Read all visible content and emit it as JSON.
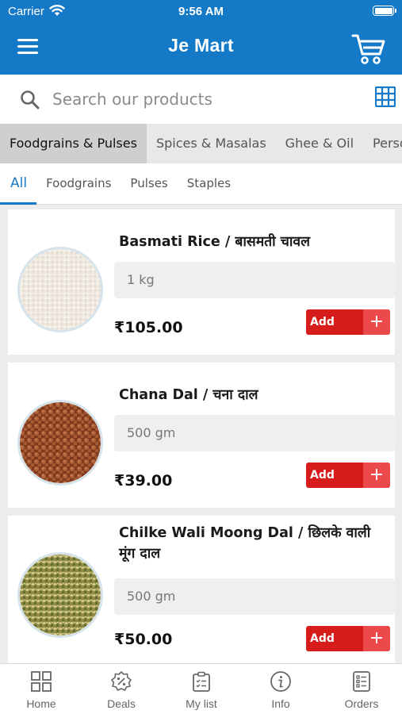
{
  "status_bar": {
    "carrier": "Carrier",
    "time": "9:56 AM"
  },
  "header": {
    "title": "Je Mart"
  },
  "search": {
    "placeholder": "Search our products"
  },
  "category_tabs": [
    "Foodgrains & Pulses",
    "Spices & Masalas",
    "Ghee & Oil",
    "Personal Care"
  ],
  "active_category": "Foodgrains & Pulses",
  "sub_tabs": [
    "All",
    "Foodgrains",
    "Pulses",
    "Staples"
  ],
  "active_sub_tab": "All",
  "products": [
    {
      "name": "Basmati Rice / बासमती चावल",
      "weight": "1 kg",
      "price": "₹105.00",
      "add_label": "Add",
      "add_symbol": "+",
      "image_color": "#ede7dc"
    },
    {
      "name": "Chana Dal / चना दाल",
      "weight": "500 gm",
      "price": "₹39.00",
      "add_label": "Add",
      "add_symbol": "+",
      "image_color": "#a55a34"
    },
    {
      "name": "Chilke Wali Moong Dal / छिलके वाली मूंग दाल",
      "weight": "500 gm",
      "price": "₹50.00",
      "add_label": "Add",
      "add_symbol": "+",
      "image_color": "#b3a85e"
    }
  ],
  "bottom_nav": [
    {
      "label": "Home",
      "icon": "grid-icon"
    },
    {
      "label": "Deals",
      "icon": "badge-percent-icon"
    },
    {
      "label": "My list",
      "icon": "clipboard-list-icon"
    },
    {
      "label": "Info",
      "icon": "info-icon"
    },
    {
      "label": "Orders",
      "icon": "order-list-icon"
    }
  ],
  "colors": {
    "brand": "#1479c7",
    "add_button": "#d71c1c",
    "add_plus": "#ec4a4a"
  }
}
